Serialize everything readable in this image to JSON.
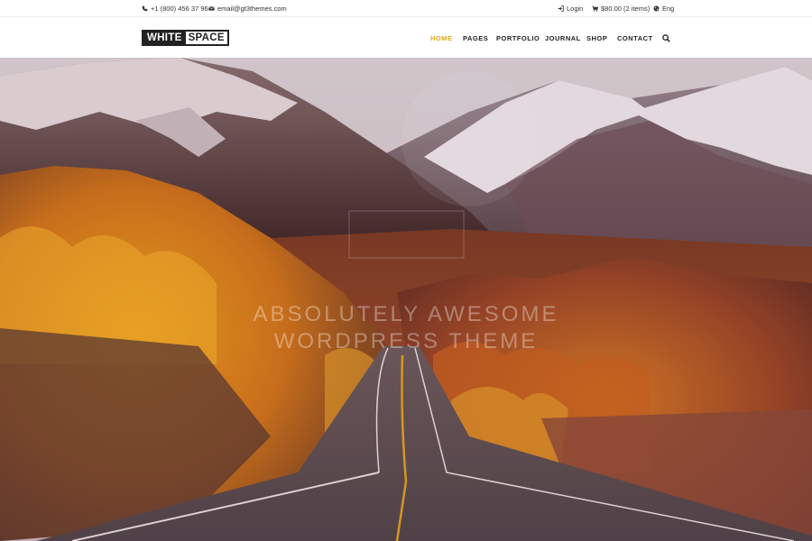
{
  "topbar": {
    "phone": "+1 (800) 456 37 96",
    "email": "email@gt3themes.com",
    "login": "Login",
    "cart": "$80.00 (2 items)",
    "language": "Eng",
    "icons": [
      "phone-icon",
      "envelope-icon",
      "sign-in-icon",
      "cart-icon",
      "globe-icon"
    ]
  },
  "header": {
    "logo_part1": "WHITE",
    "logo_part2": "SPACE",
    "nav": [
      "HOME",
      "PAGES",
      "PORTFOLIO",
      "JOURNAL",
      "SHOP",
      "CONTACT"
    ],
    "active_nav": "HOME",
    "search_icon": "search-icon"
  },
  "hero": {
    "watermark_line1": "ABSOLUTELY AWESOME",
    "watermark_line2": "WORDPRESS THEME"
  },
  "colors": {
    "accent": "#e0a91c",
    "text": "#222222",
    "topbar_border": "#eeeeee"
  }
}
